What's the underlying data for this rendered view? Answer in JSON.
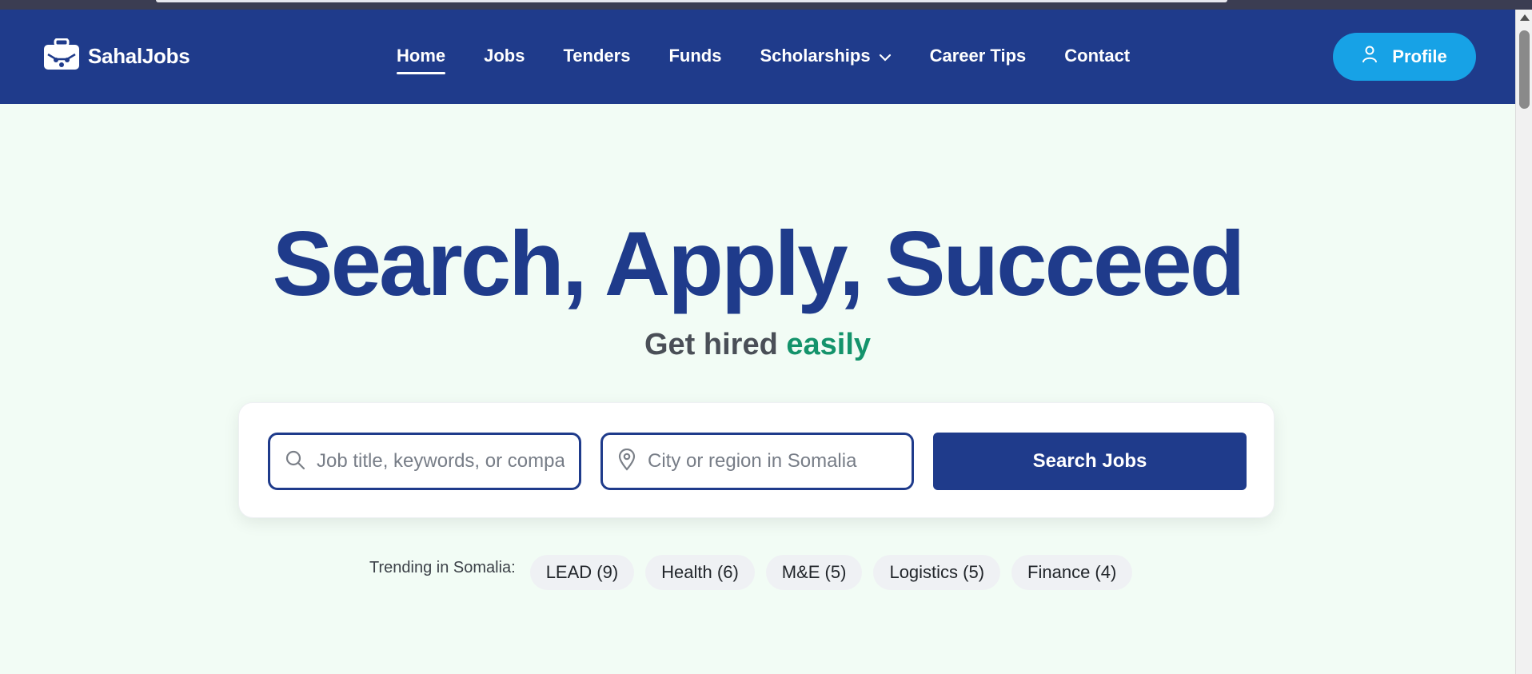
{
  "brand": {
    "name": "SahalJobs",
    "icon": "briefcase-icon"
  },
  "nav": {
    "items": [
      {
        "label": "Home",
        "active": true
      },
      {
        "label": "Jobs"
      },
      {
        "label": "Tenders"
      },
      {
        "label": "Funds"
      },
      {
        "label": "Scholarships",
        "has_dropdown": true,
        "icon": "chevron-down-icon"
      },
      {
        "label": "Career Tips"
      },
      {
        "label": "Contact"
      }
    ],
    "profile_label": "Profile",
    "profile_icon": "user-icon"
  },
  "hero": {
    "title": "Search, Apply, Succeed",
    "subtitle_prefix": "Get hired",
    "subtitle_accent": "easily"
  },
  "search": {
    "job_placeholder": "Job title, keywords, or company",
    "job_value": "",
    "location_placeholder": "City or region in Somalia",
    "location_value": "",
    "button_label": "Search Jobs",
    "job_icon": "search-icon",
    "location_icon": "map-pin-icon"
  },
  "trending": {
    "label": "Trending in Somalia:",
    "chips": [
      {
        "label": "LEAD (9)"
      },
      {
        "label": "Health (6)"
      },
      {
        "label": "M&E (5)"
      },
      {
        "label": "Logistics (5)"
      },
      {
        "label": "Finance (4)"
      }
    ]
  },
  "colors": {
    "brand_navy": "#1f3b8b",
    "accent_blue": "#17a2e6",
    "accent_green": "#14936b",
    "page_bg": "#f2fcf5"
  }
}
